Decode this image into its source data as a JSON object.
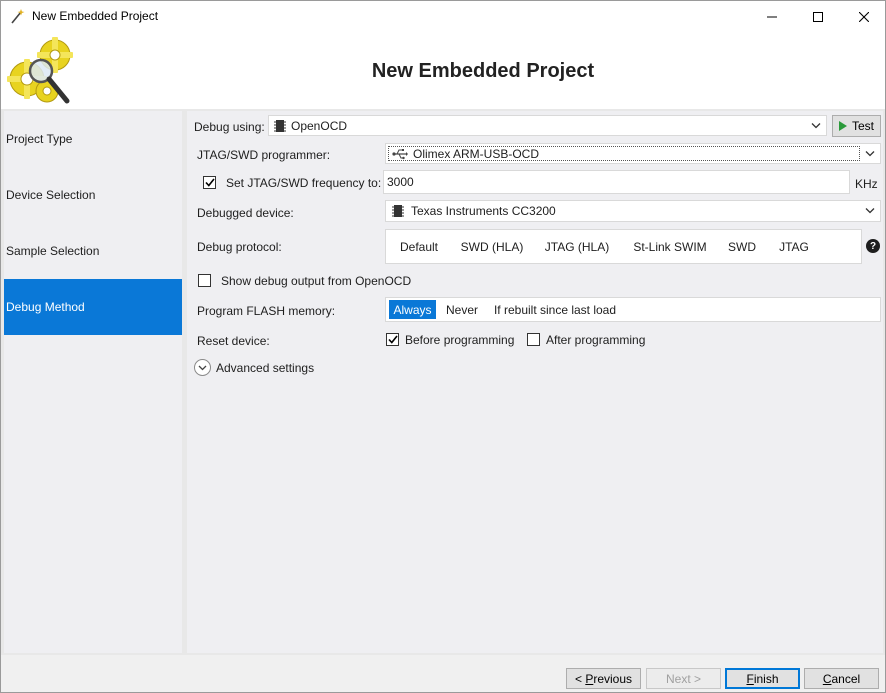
{
  "window": {
    "title": "New Embedded Project",
    "icon": "wand-icon"
  },
  "header": {
    "title": "New Embedded Project",
    "logo": "gears-magnifier-icon"
  },
  "sidebar": {
    "items": [
      {
        "label": "Project Type"
      },
      {
        "label": "Device Selection"
      },
      {
        "label": "Sample Selection"
      },
      {
        "label": "Debug Method",
        "active": true
      }
    ]
  },
  "debug_using": {
    "label": "Debug using:",
    "value": "OpenOCD",
    "test_button": "Test"
  },
  "programmer": {
    "label": "JTAG/SWD programmer:",
    "value": "Olimex ARM-USB-OCD",
    "icon": "usb-icon"
  },
  "frequency": {
    "checkbox_label": "Set JTAG/SWD frequency to:",
    "checked": true,
    "value": "3000",
    "unit": "KHz"
  },
  "debugged_device": {
    "label": "Debugged device:",
    "value": "Texas Instruments CC3200"
  },
  "debug_protocol": {
    "label": "Debug protocol:",
    "options": [
      "Default",
      "SWD (HLA)",
      "JTAG (HLA)",
      "St-Link SWIM",
      "SWD",
      "JTAG"
    ],
    "help": "?"
  },
  "show_debug_output": {
    "label": "Show debug output from OpenOCD",
    "checked": false
  },
  "program_flash": {
    "label": "Program FLASH memory:",
    "options": [
      "Always",
      "Never",
      "If rebuilt since last load"
    ],
    "selected": "Always"
  },
  "reset_device": {
    "label": "Reset device:",
    "before_label": "Before programming",
    "before_checked": true,
    "after_label": "After programming",
    "after_checked": false
  },
  "advanced": {
    "label": "Advanced settings"
  },
  "footer": {
    "previous": {
      "prefix": "< ",
      "underlined": "P",
      "rest": "revious"
    },
    "next": "Next >",
    "finish": {
      "underlined": "F",
      "rest": "inish"
    },
    "cancel": {
      "underlined": "C",
      "rest": "ancel"
    }
  },
  "colors": {
    "accent": "#0a78d7",
    "panel": "#efeff2",
    "footer": "#f0f0f0"
  }
}
